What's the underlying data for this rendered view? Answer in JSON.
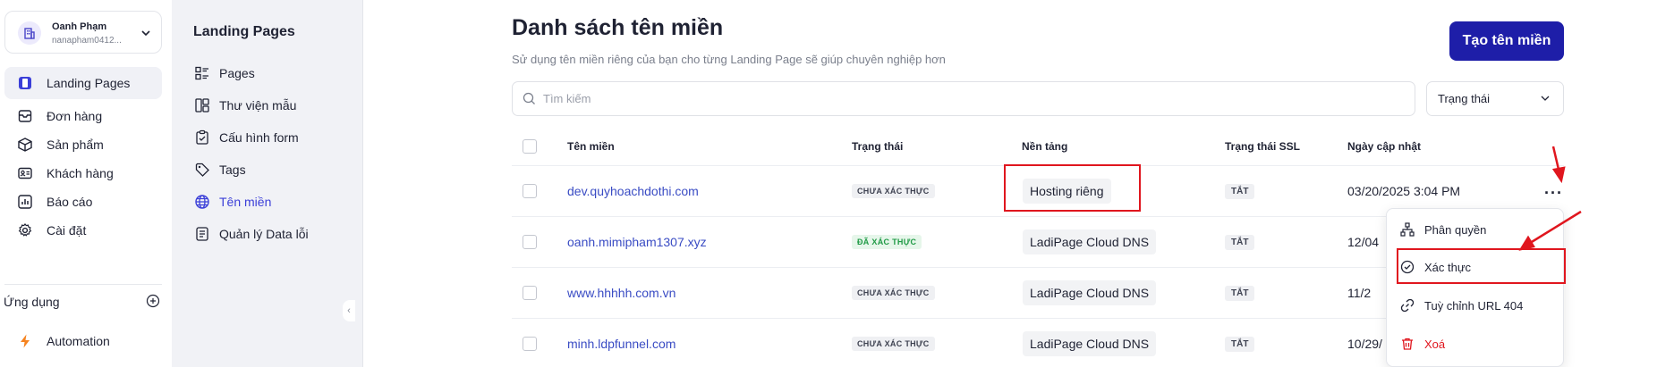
{
  "account": {
    "name": "Oanh Phạm",
    "email": "nanapham0412..."
  },
  "nav": [
    {
      "label": "Landing Pages",
      "icon": "landing-pages-icon",
      "active": true
    },
    {
      "label": "Đơn hàng",
      "icon": "orders-icon"
    },
    {
      "label": "Sản phẩm",
      "icon": "product-box-icon"
    },
    {
      "label": "Khách hàng",
      "icon": "customer-card-icon"
    },
    {
      "label": "Báo cáo",
      "icon": "report-chart-icon"
    },
    {
      "label": "Cài đặt",
      "icon": "gear-icon"
    }
  ],
  "apps": {
    "title": "Ứng dụng",
    "items": [
      {
        "label": "Automation",
        "icon": "lightning-icon"
      }
    ]
  },
  "subnav": {
    "title": "Landing Pages",
    "items": [
      {
        "label": "Pages",
        "icon": "pages-icon"
      },
      {
        "label": "Thư viện mẫu",
        "icon": "template-library-icon"
      },
      {
        "label": "Cấu hình form",
        "icon": "form-config-icon"
      },
      {
        "label": "Tags",
        "icon": "tag-icon"
      },
      {
        "label": "Tên miền",
        "icon": "globe-icon",
        "active": true
      },
      {
        "label": "Quản lý Data lỗi",
        "icon": "error-data-icon"
      }
    ]
  },
  "header": {
    "title": "Danh sách tên miền",
    "subtitle": "Sử dụng tên miền riêng của bạn cho từng Landing Page sẽ giúp chuyên nghiệp hơn",
    "create_label": "Tạo tên miền"
  },
  "search": {
    "placeholder": "Tìm kiếm"
  },
  "filter": {
    "status_label": "Trạng thái"
  },
  "table": {
    "columns": [
      "Tên miền",
      "Trạng thái",
      "Nền tảng",
      "Trạng thái SSL",
      "Ngày cập nhật"
    ],
    "rows": [
      {
        "domain": "dev.quyhoachdothi.com",
        "status": "CHƯA XÁC THỰC",
        "platform": "Hosting riêng",
        "ssl": "TẮT",
        "updated": "03/20/2025 3:04 PM"
      },
      {
        "domain": "oanh.mimipham1307.xyz",
        "status": "ĐÃ XÁC THỰC",
        "platform": "LadiPage Cloud DNS",
        "ssl": "TẮT",
        "updated": "12/04"
      },
      {
        "domain": "www.hhhhh.com.vn",
        "status": "CHƯA XÁC THỰC",
        "platform": "LadiPage Cloud DNS",
        "ssl": "TẮT",
        "updated": "11/2"
      },
      {
        "domain": "minh.ldpfunnel.com",
        "status": "CHƯA XÁC THỰC",
        "platform": "LadiPage Cloud DNS",
        "ssl": "TẮT",
        "updated": "10/29/"
      }
    ],
    "more_label": "···"
  },
  "dropdown": {
    "items": [
      {
        "label": "Phân quyền",
        "icon": "hierarchy-icon"
      },
      {
        "label": "Xác thực",
        "icon": "check-circle-icon"
      },
      {
        "label": "Tuỳ chỉnh URL 404",
        "icon": "link-icon"
      },
      {
        "label": "Xoá",
        "icon": "trash-icon"
      }
    ]
  },
  "colors": {
    "primary": "#1e1ea8",
    "accent": "#3b3fd8",
    "link": "#3a4cc4",
    "annotation": "#e0161e",
    "verified": "#1f9a45"
  }
}
